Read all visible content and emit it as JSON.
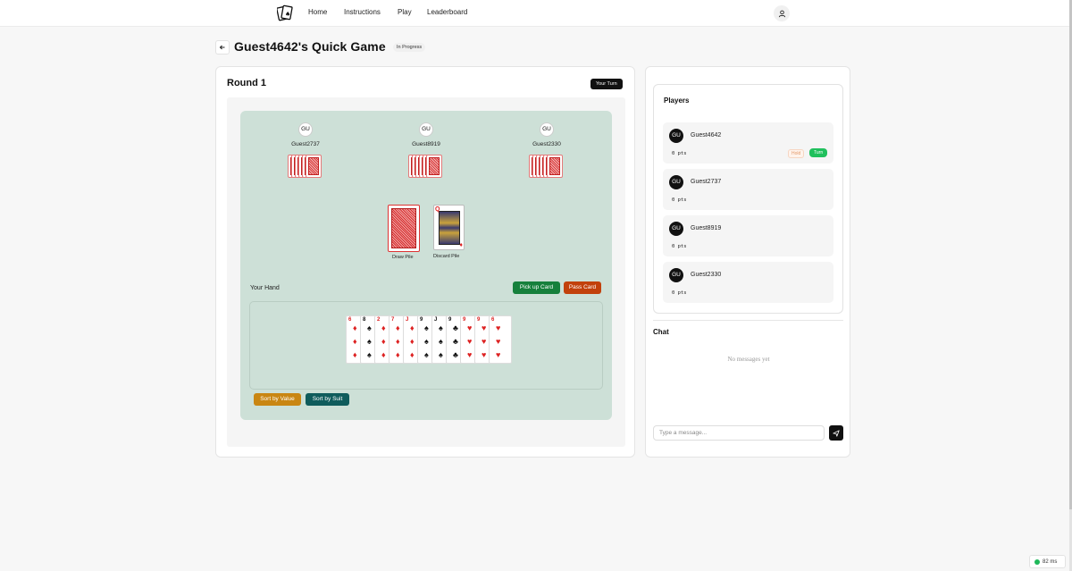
{
  "nav": {
    "links": [
      "Home",
      "Instructions",
      "Play",
      "Leaderboard"
    ]
  },
  "header": {
    "title": "Guest4642's Quick Game",
    "status": "In Progress"
  },
  "game": {
    "round_label": "Round 1",
    "turn_badge": "Your Turn",
    "opponents": [
      {
        "avatar": "GU",
        "name": "Guest2737"
      },
      {
        "avatar": "GU",
        "name": "Guest8919"
      },
      {
        "avatar": "GU",
        "name": "Guest2330"
      }
    ],
    "draw_pile_label": "Draw Pile",
    "discard_pile_label": "Discard Pile",
    "discard_top": {
      "rank": "Q",
      "suit": "♦",
      "color": "#d22"
    },
    "your_hand_label": "Your Hand",
    "pickup_label": "Pick up Card",
    "pass_label": "Pass Card",
    "hand": [
      {
        "rank": "6",
        "suit": "♦",
        "color": "#d22"
      },
      {
        "rank": "8",
        "suit": "♠",
        "color": "#111"
      },
      {
        "rank": "2",
        "suit": "♦",
        "color": "#d22"
      },
      {
        "rank": "7",
        "suit": "♦",
        "color": "#d22"
      },
      {
        "rank": "J",
        "suit": "♦",
        "color": "#d22"
      },
      {
        "rank": "9",
        "suit": "♠",
        "color": "#111"
      },
      {
        "rank": "J",
        "suit": "♠",
        "color": "#111"
      },
      {
        "rank": "9",
        "suit": "♣",
        "color": "#111"
      },
      {
        "rank": "9",
        "suit": "♥",
        "color": "#d22"
      },
      {
        "rank": "9",
        "suit": "♥",
        "color": "#d22"
      },
      {
        "rank": "6",
        "suit": "♥",
        "color": "#d22"
      }
    ],
    "sort_value_label": "Sort by Value",
    "sort_suit_label": "Sort by Suit"
  },
  "players": {
    "title": "Players",
    "list": [
      {
        "avatar": "GU",
        "name": "Guest4642",
        "pts": "0 pts",
        "hold": "Hold",
        "turn": "Turn"
      },
      {
        "avatar": "GU",
        "name": "Guest2737",
        "pts": "0 pts"
      },
      {
        "avatar": "GU",
        "name": "Guest8919",
        "pts": "0 pts"
      },
      {
        "avatar": "GU",
        "name": "Guest2330",
        "pts": "0 pts"
      }
    ]
  },
  "chat": {
    "title": "Chat",
    "empty_text": "No messages yet",
    "placeholder": "Type a message..."
  },
  "latency": "82 ms"
}
